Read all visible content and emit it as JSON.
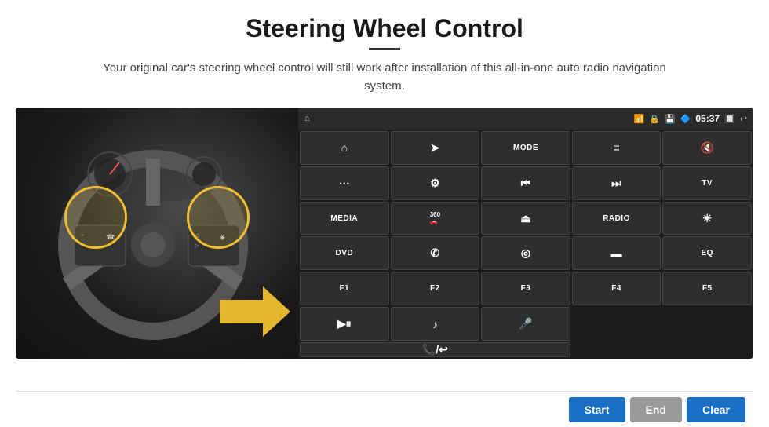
{
  "page": {
    "title": "Steering Wheel Control",
    "subtitle": "Your original car's steering wheel control will still work after installation of this all-in-one auto radio navigation system.",
    "divider": true
  },
  "status_bar": {
    "time": "05:37",
    "icons": [
      "wifi",
      "lock",
      "sd",
      "bluetooth",
      "battery",
      "home",
      "back"
    ]
  },
  "grid_buttons": [
    {
      "id": "btn-home",
      "icon": "⌂",
      "text": "",
      "row": 1,
      "col": 1
    },
    {
      "id": "btn-nav",
      "icon": "➤",
      "text": "",
      "row": 1,
      "col": 2
    },
    {
      "id": "btn-mode",
      "icon": "",
      "text": "MODE",
      "row": 1,
      "col": 3
    },
    {
      "id": "btn-list",
      "icon": "≡",
      "text": "",
      "row": 1,
      "col": 4
    },
    {
      "id": "btn-mute",
      "icon": "🔇",
      "text": "",
      "row": 1,
      "col": 5
    },
    {
      "id": "btn-apps",
      "icon": "⋯",
      "text": "",
      "row": 1,
      "col": 6
    },
    {
      "id": "btn-settings",
      "icon": "⚙",
      "text": "",
      "row": 2,
      "col": 1
    },
    {
      "id": "btn-prev",
      "icon": "⏮",
      "text": "",
      "row": 2,
      "col": 2
    },
    {
      "id": "btn-next",
      "icon": "⏭",
      "text": "",
      "row": 2,
      "col": 3
    },
    {
      "id": "btn-tv",
      "icon": "",
      "text": "TV",
      "row": 2,
      "col": 4
    },
    {
      "id": "btn-media",
      "icon": "",
      "text": "MEDIA",
      "row": 2,
      "col": 5
    },
    {
      "id": "btn-360",
      "icon": "360",
      "text": "",
      "row": 3,
      "col": 1
    },
    {
      "id": "btn-eject",
      "icon": "⏏",
      "text": "",
      "row": 3,
      "col": 2
    },
    {
      "id": "btn-radio",
      "icon": "",
      "text": "RADIO",
      "row": 3,
      "col": 3
    },
    {
      "id": "btn-brightness",
      "icon": "☀",
      "text": "",
      "row": 3,
      "col": 4
    },
    {
      "id": "btn-dvd",
      "icon": "",
      "text": "DVD",
      "row": 3,
      "col": 5
    },
    {
      "id": "btn-phone",
      "icon": "✆",
      "text": "",
      "row": 4,
      "col": 1
    },
    {
      "id": "btn-maps",
      "icon": "◎",
      "text": "",
      "row": 4,
      "col": 2
    },
    {
      "id": "btn-screen",
      "icon": "▬",
      "text": "",
      "row": 4,
      "col": 3
    },
    {
      "id": "btn-eq",
      "icon": "",
      "text": "EQ",
      "row": 4,
      "col": 4
    },
    {
      "id": "btn-f1",
      "icon": "",
      "text": "F1",
      "row": 4,
      "col": 5
    },
    {
      "id": "btn-f2",
      "icon": "",
      "text": "F2",
      "row": 5,
      "col": 1
    },
    {
      "id": "btn-f3",
      "icon": "",
      "text": "F3",
      "row": 5,
      "col": 2
    },
    {
      "id": "btn-f4",
      "icon": "",
      "text": "F4",
      "row": 5,
      "col": 3
    },
    {
      "id": "btn-f5",
      "icon": "",
      "text": "F5",
      "row": 5,
      "col": 4
    },
    {
      "id": "btn-playpause",
      "icon": "⏵⏸",
      "text": "",
      "row": 5,
      "col": 5
    },
    {
      "id": "btn-music",
      "icon": "♪",
      "text": "",
      "row": 6,
      "col": 1
    },
    {
      "id": "btn-mic",
      "icon": "🎤",
      "text": "",
      "row": 6,
      "col": 2
    },
    {
      "id": "btn-call",
      "icon": "📞",
      "text": "",
      "row": 6,
      "col": 3
    }
  ],
  "bottom_bar": {
    "start_label": "Start",
    "end_label": "End",
    "clear_label": "Clear"
  }
}
